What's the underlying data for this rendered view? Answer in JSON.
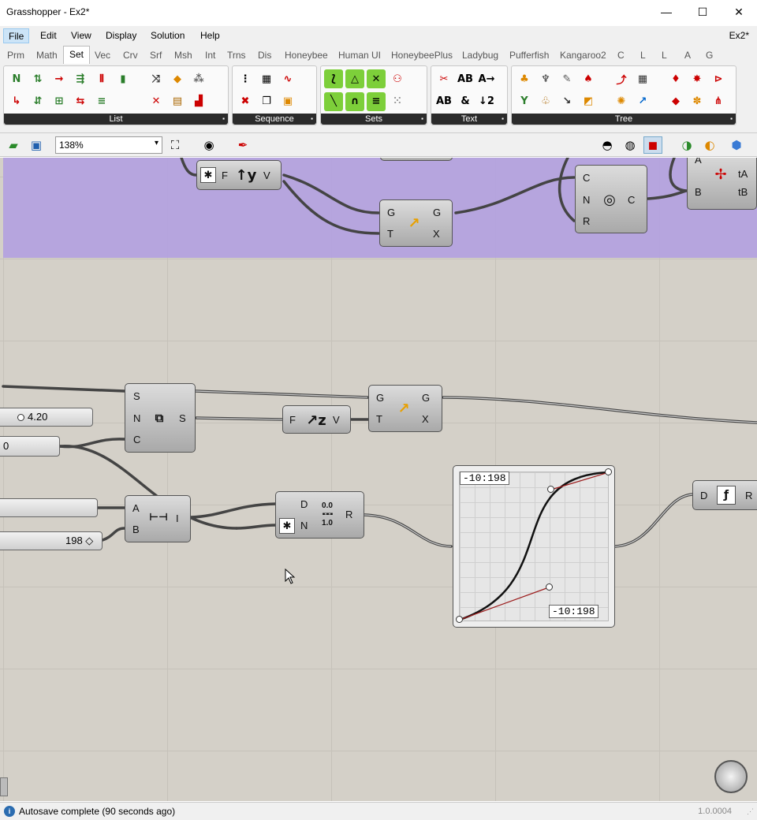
{
  "window": {
    "title": "Grasshopper - Ex2*",
    "minimize": "—",
    "maximize": "☐",
    "close": "✕"
  },
  "menubar": {
    "items": [
      "File",
      "Edit",
      "View",
      "Display",
      "Solution",
      "Help"
    ],
    "doc_tab": "Ex2*"
  },
  "tabs": [
    "Prm",
    "Math",
    "Set",
    "Vec",
    "Crv",
    "Srf",
    "Msh",
    "Int",
    "Trns",
    "Dis",
    "Honeybee",
    "Human UI",
    "HoneybeePlus",
    "Ladybug",
    "Pufferfish",
    "Kangaroo2",
    "C",
    "L",
    "L",
    "A",
    "G"
  ],
  "active_tab": "Set",
  "ribbon": {
    "panels": [
      {
        "label": "List"
      },
      {
        "label": "Sequence"
      },
      {
        "label": "Sets"
      },
      {
        "label": "Text"
      },
      {
        "label": "Tree"
      }
    ]
  },
  "canvas_toolbar": {
    "zoom": "138%"
  },
  "nodes": {
    "dz_top": {
      "in": "F",
      "out": "V"
    },
    "eval_top": {
      "in": [
        "G",
        "T"
      ],
      "out": [
        "G",
        "X"
      ]
    },
    "circle": {
      "in": [
        "C",
        "N",
        "R"
      ],
      "out": "C"
    },
    "split": {
      "in": [
        "A",
        "B"
      ],
      "out": [
        "tA",
        "tB"
      ]
    },
    "series": {
      "in": [
        "S",
        "N",
        "C"
      ],
      "out": "S"
    },
    "dz_mid": {
      "in": "F",
      "out": "V"
    },
    "eval_mid": {
      "in": [
        "G",
        "T"
      ],
      "out": [
        "G",
        "X"
      ]
    },
    "bounds": {
      "in": [
        "A",
        "B"
      ],
      "out": "I"
    },
    "remap": {
      "in": [
        "D",
        "N"
      ],
      "out": "R",
      "icon_top": "0.0",
      "icon_bottom": "1.0"
    },
    "right_node": {
      "in": "D",
      "out": "R"
    }
  },
  "sliders": {
    "s1": "4.20",
    "s2": "0",
    "s3": "",
    "s4": "198 ◇"
  },
  "graph_mapper": {
    "top_label": "-10:198",
    "bottom_label": "-10:198"
  },
  "statusbar": {
    "text": "Autosave complete (90 seconds ago)",
    "version": "1.0.0004"
  }
}
